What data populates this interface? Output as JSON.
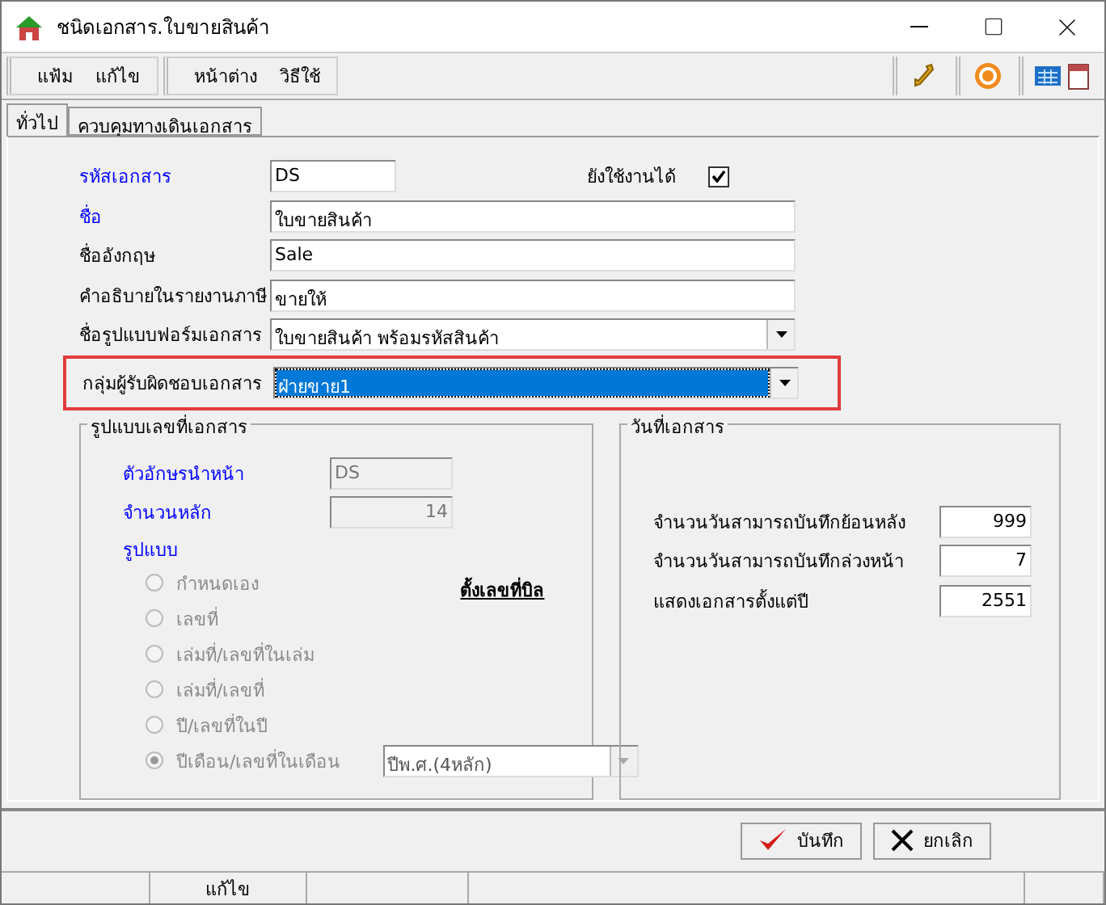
{
  "window": {
    "title": "ชนิดเอกสาร.ใบขายสินค้า"
  },
  "menu": [
    {
      "group": [
        "แฟ้ม",
        "แก้ไข"
      ]
    },
    {
      "group": [
        "หน้าต่าง",
        "วิธีใช้"
      ]
    }
  ],
  "tabs": [
    {
      "label": "ทั่วไป",
      "selected": true
    },
    {
      "label": "ควบคุมทางเดินเอกสาร",
      "selected": false
    }
  ],
  "form": {
    "code": {
      "label": "รหัสเอกสาร",
      "value": "DS",
      "required": true
    },
    "active": {
      "label": "ยังใช้งานได้",
      "checked": true
    },
    "fields": [
      {
        "label": "ชื่อ",
        "value": "ใบขายสินค้า",
        "required": true,
        "kind": "text"
      },
      {
        "label": "ชื่ออังกฤษ",
        "value": "Sale",
        "required": false,
        "kind": "text"
      },
      {
        "label": "คำอธิบายในรายงานภาษี",
        "value": "ขายให้",
        "required": false,
        "kind": "text"
      },
      {
        "label": "ชื่อรูปแบบฟอร์มเอกสาร",
        "value": "ใบขายสินค้า พร้อมรหัสสินค้า",
        "required": false,
        "kind": "dropdown"
      },
      {
        "label": "กลุ่มผู้รับผิดชอบเอกสาร",
        "value": "ฝ่ายขาย1",
        "required": false,
        "kind": "dropdown",
        "focused": true,
        "highlighted": true
      }
    ]
  },
  "numbering": {
    "title": "รูปแบบเลขที่เอกสาร",
    "prefix": {
      "label": "ตัวอักษรนำหน้า",
      "value": "DS"
    },
    "digits": {
      "label": "จำนวนหลัก",
      "value": "14"
    },
    "format_label": "รูปแบบ",
    "link": "ตั้งเลขที่บิล",
    "options": [
      {
        "label": "กำหนดเอง",
        "selected": false
      },
      {
        "label": "เลขที่",
        "selected": false
      },
      {
        "label": "เล่มที่/เลขที่ในเล่ม",
        "selected": false
      },
      {
        "label": "เล่มที่/เลขที่",
        "selected": false
      },
      {
        "label": "ปี/เลขที่ในปี",
        "selected": false
      },
      {
        "label": "ปีเดือน/เลขที่ในเดือน",
        "selected": true
      }
    ],
    "options_disabled": true,
    "year_format": "ปีพ.ศ.(4หลัก)"
  },
  "dates": {
    "title": "วันที่เอกสาร",
    "rows": [
      {
        "label": "จำนวนวันสามารถบันทึกย้อนหลัง",
        "value": "999"
      },
      {
        "label": "จำนวนวันสามารถบันทึกล่วงหน้า",
        "value": "7"
      },
      {
        "label": "แสดงเอกสารตั้งแต่ปี",
        "value": "2551"
      }
    ]
  },
  "buttons": [
    {
      "label": "บันทึก",
      "kind": "save"
    },
    {
      "label": "ยกเลิก",
      "kind": "cancel"
    }
  ],
  "status_bar": {
    "mode": "แก้ไข"
  }
}
